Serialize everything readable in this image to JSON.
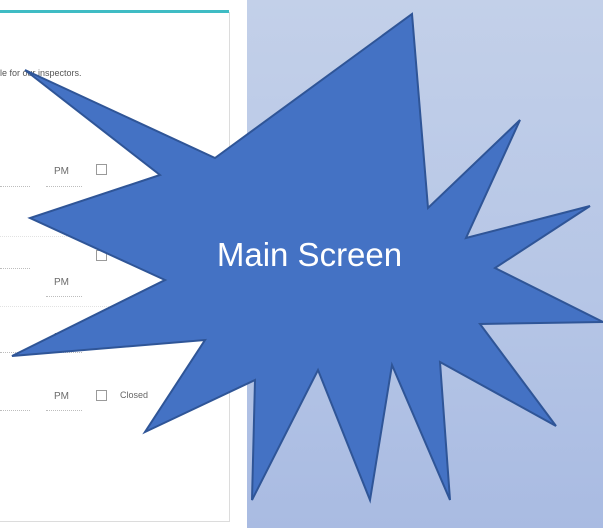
{
  "form": {
    "intro_text": "le for our inspectors.",
    "rows": [
      {
        "period": "PM",
        "checkbox_label": ""
      },
      {
        "period": "PM",
        "checkbox_label": ""
      },
      {
        "period": "PM",
        "checkbox_label": ""
      },
      {
        "period": "PM",
        "checkbox_label": "Closed"
      }
    ]
  },
  "callout": {
    "label": "Main Screen",
    "fill_color": "#4472c4",
    "stroke_color": "#2f5597"
  },
  "colors": {
    "accent": "#3fbcc4",
    "panel_top": "#c3d0e9",
    "panel_bottom": "#a9bbe2"
  }
}
